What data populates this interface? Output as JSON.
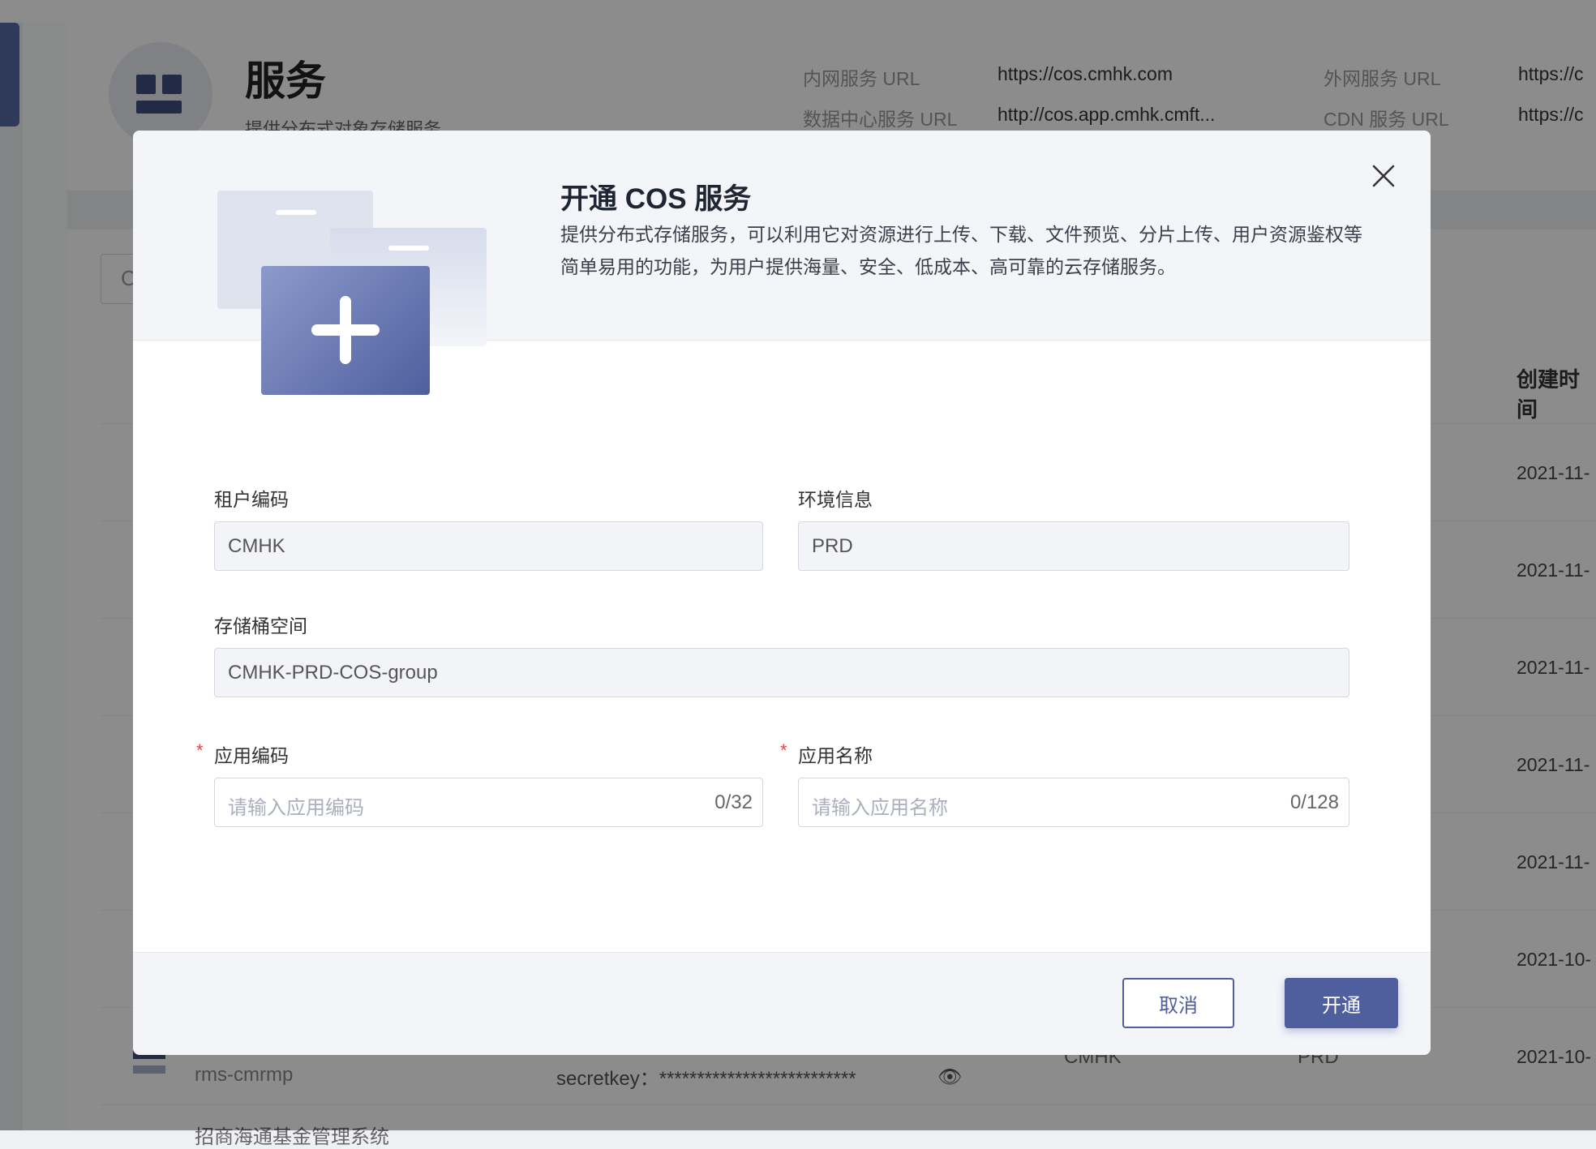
{
  "background": {
    "service_title": "服务",
    "service_desc": "提供分布式对象存储服务",
    "urls": [
      {
        "label": "内网服务 URL",
        "value": "https://cos.cmhk.com"
      },
      {
        "label": "数据中心服务 URL",
        "value": "http://cos.app.cmhk.cmft..."
      },
      {
        "label": "外网服务 URL",
        "value": "https://c"
      },
      {
        "label": "CDN 服务 URL",
        "value": "https://c"
      }
    ],
    "search_initial": "C",
    "column_created": "创建时间",
    "row_dates": [
      "2021-11-",
      "2021-11-",
      "2021-11-",
      "2021-11-",
      "2021-11-",
      "2021-10-",
      "2021-10-"
    ],
    "bottom_row": {
      "name": "rms-cmrmp",
      "secret": "secretkey：**************************",
      "tenant": "CMHK",
      "env": "PRD"
    },
    "cut_text": "招商海通基金管理系统"
  },
  "modal": {
    "title": "开通 COS 服务",
    "description": "提供分布式存储服务，可以利用它对资源进行上传、下载、文件预览、分片上传、用户资源鉴权等简单易用的功能，为用户提供海量、安全、低成本、高可靠的云存储服务。",
    "fields": {
      "tenant_code": {
        "label": "租户编码",
        "value": "CMHK"
      },
      "env_info": {
        "label": "环境信息",
        "value": "PRD"
      },
      "bucket_space": {
        "label": "存储桶空间",
        "value": "CMHK-PRD-COS-group"
      },
      "app_code": {
        "label": "应用编码",
        "placeholder": "请输入应用编码",
        "counter": "0/32",
        "required_mark": "*"
      },
      "app_name": {
        "label": "应用名称",
        "placeholder": "请输入应用名称",
        "counter": "0/128",
        "required_mark": "*"
      }
    },
    "buttons": {
      "cancel": "取消",
      "confirm": "开通"
    }
  },
  "colors": {
    "primary": "#4f5f9e",
    "required": "#e8453c",
    "overlay": "rgba(0,0,0,0.45)"
  },
  "icons": [
    "close-icon",
    "add-service-illustration",
    "service-grid-icon",
    "eye-icon"
  ]
}
